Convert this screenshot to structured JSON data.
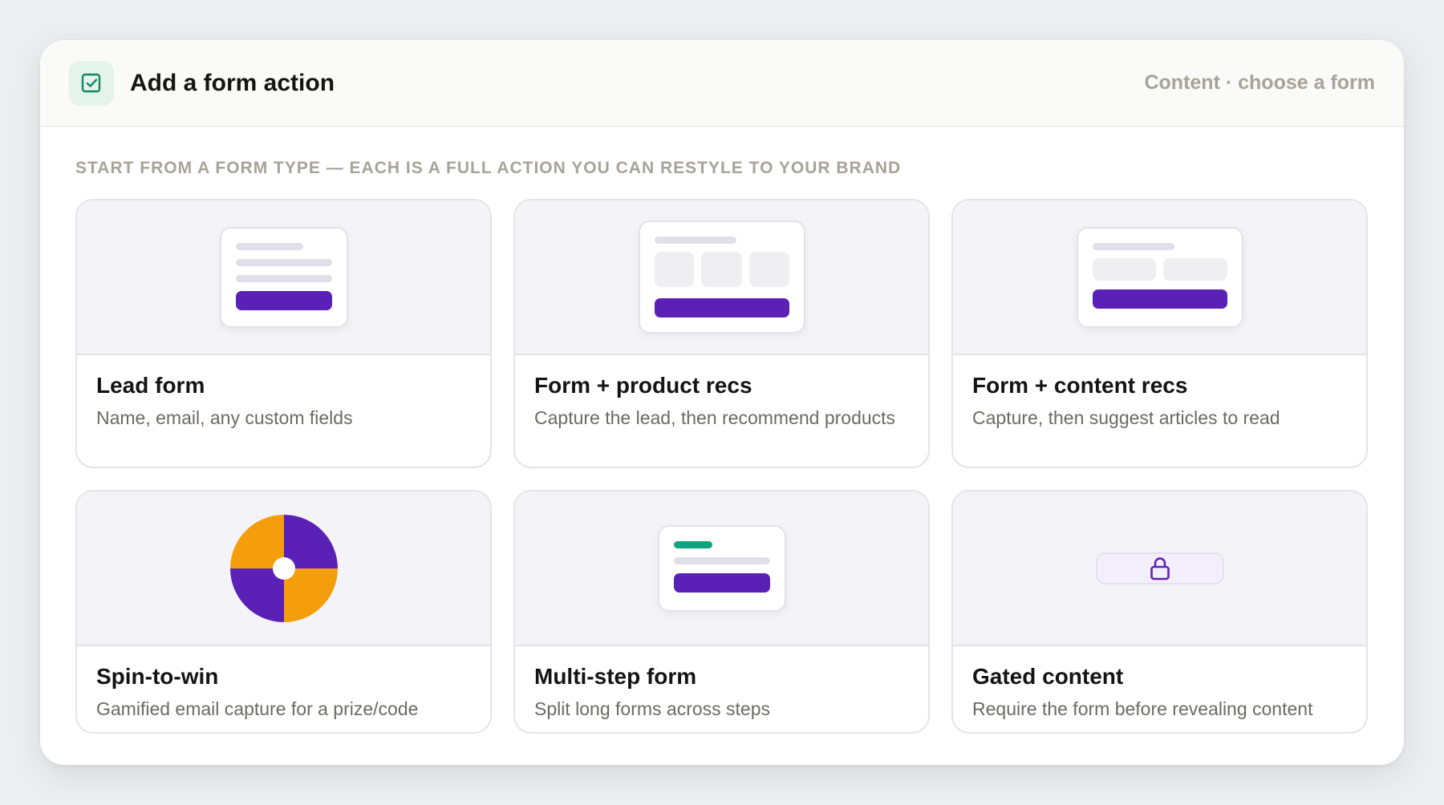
{
  "header": {
    "title": "Add a form action",
    "breadcrumb": "Content · choose a form",
    "icon": "checkbox-icon"
  },
  "intro": "START FROM A FORM TYPE — EACH IS A FULL ACTION YOU CAN RESTYLE TO YOUR BRAND",
  "cards": [
    {
      "title": "Lead form",
      "description": "Name, email, any custom fields"
    },
    {
      "title": "Form + product recs",
      "description": "Capture the lead, then recommend products"
    },
    {
      "title": "Form + content recs",
      "description": "Capture, then suggest articles to read"
    },
    {
      "title": "Spin-to-win",
      "description": "Gamified email capture for a prize/code"
    },
    {
      "title": "Multi-step form",
      "description": "Split long forms across steps"
    },
    {
      "title": "Gated content",
      "description": "Require the form before revealing content"
    }
  ],
  "colors": {
    "accent_purple": "#5b21b6",
    "accent_orange": "#f59e0b",
    "accent_green": "#10a37f",
    "muted_text": "#a8a398"
  }
}
